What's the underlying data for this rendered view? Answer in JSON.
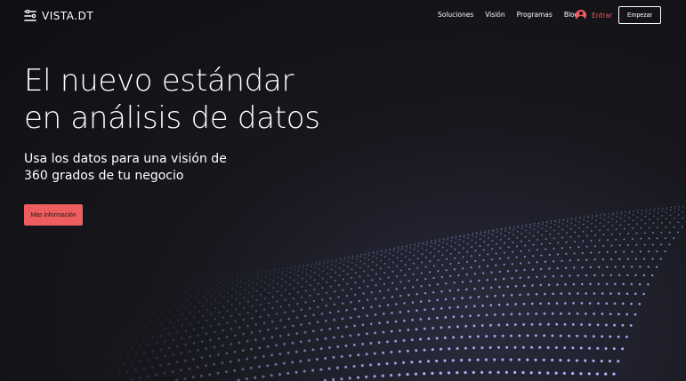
{
  "brand": {
    "name": "VISTA.DT",
    "icon": "logo-mark-icon"
  },
  "nav": {
    "items": [
      {
        "label": "Soluciones"
      },
      {
        "label": "Visión"
      },
      {
        "label": "Programas"
      },
      {
        "label": "Blog"
      }
    ],
    "login_label": "Entrar",
    "login_icon": "user-avatar-icon",
    "start_label": "Empezar"
  },
  "hero": {
    "headline_line1": "El nuevo estándar",
    "headline_line2": "en análisis de datos",
    "subhead_line1": "Usa los datos para una visión de",
    "subhead_line2": "360 grados de tu negocio",
    "cta_label": "Más información"
  },
  "colors": {
    "background": "#121216",
    "accent": "#f05d5e",
    "text": "#ffffff",
    "dots": "#aab4ff"
  }
}
